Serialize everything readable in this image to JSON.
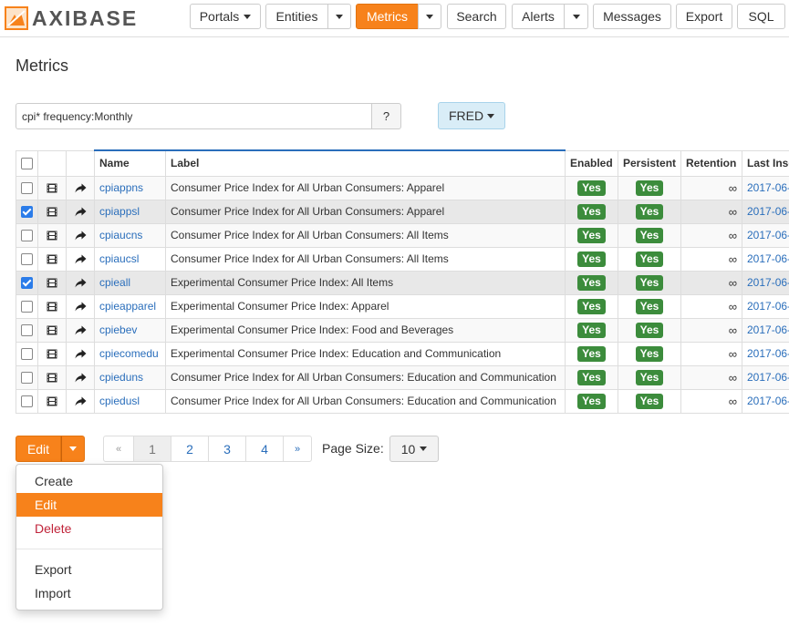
{
  "brand": {
    "name": "AXIBASE",
    "accent": "#f7821b"
  },
  "nav": {
    "portals": "Portals",
    "entities": "Entities",
    "metrics": "Metrics",
    "search": "Search",
    "alerts": "Alerts",
    "messages": "Messages",
    "export": "Export",
    "sql": "SQL"
  },
  "page": {
    "title": "Metrics"
  },
  "search": {
    "value": "cpi* frequency:Monthly",
    "help_label": "?"
  },
  "fred_button": "FRED",
  "table": {
    "headers": {
      "name": "Name",
      "label": "Label",
      "enabled": "Enabled",
      "persistent": "Persistent",
      "retention": "Retention",
      "last_insert": "Last Insert"
    },
    "rows": [
      {
        "checked": false,
        "name": "cpiappns",
        "label": "Consumer Price Index for All Urban Consumers: Apparel",
        "enabled": "Yes",
        "persistent": "Yes",
        "retention": "∞",
        "last_insert": "2017-06-"
      },
      {
        "checked": true,
        "name": "cpiappsl",
        "label": "Consumer Price Index for All Urban Consumers: Apparel",
        "enabled": "Yes",
        "persistent": "Yes",
        "retention": "∞",
        "last_insert": "2017-06-"
      },
      {
        "checked": false,
        "name": "cpiaucns",
        "label": "Consumer Price Index for All Urban Consumers: All Items",
        "enabled": "Yes",
        "persistent": "Yes",
        "retention": "∞",
        "last_insert": "2017-06-"
      },
      {
        "checked": false,
        "name": "cpiaucsl",
        "label": "Consumer Price Index for All Urban Consumers: All Items",
        "enabled": "Yes",
        "persistent": "Yes",
        "retention": "∞",
        "last_insert": "2017-06-"
      },
      {
        "checked": true,
        "name": "cpieall",
        "label": "Experimental Consumer Price Index: All Items",
        "enabled": "Yes",
        "persistent": "Yes",
        "retention": "∞",
        "last_insert": "2017-06-"
      },
      {
        "checked": false,
        "name": "cpieapparel",
        "label": "Experimental Consumer Price Index: Apparel",
        "enabled": "Yes",
        "persistent": "Yes",
        "retention": "∞",
        "last_insert": "2017-06-"
      },
      {
        "checked": false,
        "name": "cpiebev",
        "label": "Experimental Consumer Price Index: Food and Beverages",
        "enabled": "Yes",
        "persistent": "Yes",
        "retention": "∞",
        "last_insert": "2017-06-"
      },
      {
        "checked": false,
        "name": "cpiecomedu",
        "label": "Experimental Consumer Price Index: Education and Communication",
        "enabled": "Yes",
        "persistent": "Yes",
        "retention": "∞",
        "last_insert": "2017-06-"
      },
      {
        "checked": false,
        "name": "cpieduns",
        "label": "Consumer Price Index for All Urban Consumers: Education and Communication",
        "enabled": "Yes",
        "persistent": "Yes",
        "retention": "∞",
        "last_insert": "2017-06-"
      },
      {
        "checked": false,
        "name": "cpiedusl",
        "label": "Consumer Price Index for All Urban Consumers: Education and Communication",
        "enabled": "Yes",
        "persistent": "Yes",
        "retention": "∞",
        "last_insert": "2017-06-"
      }
    ]
  },
  "actions": {
    "edit_label": "Edit"
  },
  "pagination": {
    "prev": "«",
    "pages": [
      "1",
      "2",
      "3",
      "4"
    ],
    "current": "1",
    "next": "»",
    "page_size_label": "Page Size:",
    "page_size": "10"
  },
  "edit_menu": {
    "items": [
      {
        "label": "Create",
        "state": "normal"
      },
      {
        "label": "Edit",
        "state": "active"
      },
      {
        "label": "Delete",
        "state": "danger"
      },
      {
        "label": "Export",
        "state": "normal"
      },
      {
        "label": "Import",
        "state": "normal"
      }
    ]
  },
  "icons": {
    "logo": "axibase-logo-icon",
    "row_icon_1": "film-icon",
    "row_icon_2": "share-arrow-icon",
    "dropdown": "caret-down-icon"
  },
  "colors": {
    "accent": "#f7821b",
    "link": "#2a6ebb",
    "badge_green": "#3c8c3c",
    "info_button": "#d9edf7",
    "danger": "#c0243a",
    "checkbox_checked": "#2b7ce9"
  }
}
